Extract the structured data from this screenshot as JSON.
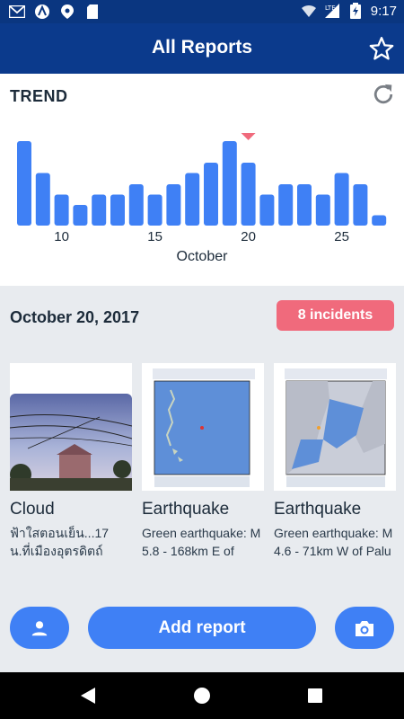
{
  "status_bar": {
    "time": "9:17",
    "network": "LTE",
    "left_icons": [
      "gmail-icon",
      "app-a-icon",
      "location-pin-icon",
      "sd-card-icon"
    ],
    "right_icons": [
      "wifi-icon",
      "lte-signal-icon",
      "battery-charging-icon"
    ]
  },
  "app_bar": {
    "title": "All Reports",
    "star_icon": "star-outline-icon"
  },
  "trend": {
    "title": "TREND",
    "refresh_icon": "refresh-icon",
    "x_axis_label": "October",
    "selected_day": 20
  },
  "chart_data": {
    "type": "bar",
    "title": "TREND",
    "xlabel": "October",
    "ylabel": "",
    "days": [
      8,
      9,
      10,
      11,
      12,
      13,
      14,
      15,
      16,
      17,
      18,
      19,
      20,
      21,
      22,
      23,
      24,
      25,
      26,
      27,
      28
    ],
    "values": [
      9,
      5.6,
      3.3,
      2.2,
      3.3,
      3.3,
      4.4,
      3.3,
      4.4,
      5.6,
      6.7,
      9,
      6.7,
      3.3,
      4.4,
      4.4,
      3.3,
      5.6,
      4.4,
      1.1,
      0
    ],
    "tick_labels": [
      "10",
      "15",
      "20",
      "25"
    ],
    "tick_values": [
      10,
      15,
      20,
      25
    ],
    "highlight_day": 20,
    "bar_color": "#3f80f5",
    "marker_color": "#f06a7c",
    "grid": false
  },
  "selected_date": {
    "label": "October 20, 2017",
    "incidents": "8 incidents",
    "badge_color": "#f06a7c"
  },
  "reports": [
    {
      "category": "Cloud",
      "description": "ฟ้าใสตอนเย็น...17 น.ที่เมืองอุตรดิตถ์",
      "image": "sky-photo"
    },
    {
      "category": "Earthquake",
      "description": "Green earthquake: M 5.8 - 168km E of",
      "image": "usgs-shakemap"
    },
    {
      "category": "Earthquake",
      "description": "Green earthquake: M 4.6 - 71km W of Palu",
      "image": "usgs-shakemap-palu"
    }
  ],
  "actions": {
    "add_report_label": "Add report",
    "profile_icon": "person-icon",
    "camera_icon": "camera-icon",
    "button_color": "#3f80f5"
  },
  "nav_bar": {
    "icons": [
      "back-icon",
      "home-icon",
      "recents-icon"
    ]
  }
}
